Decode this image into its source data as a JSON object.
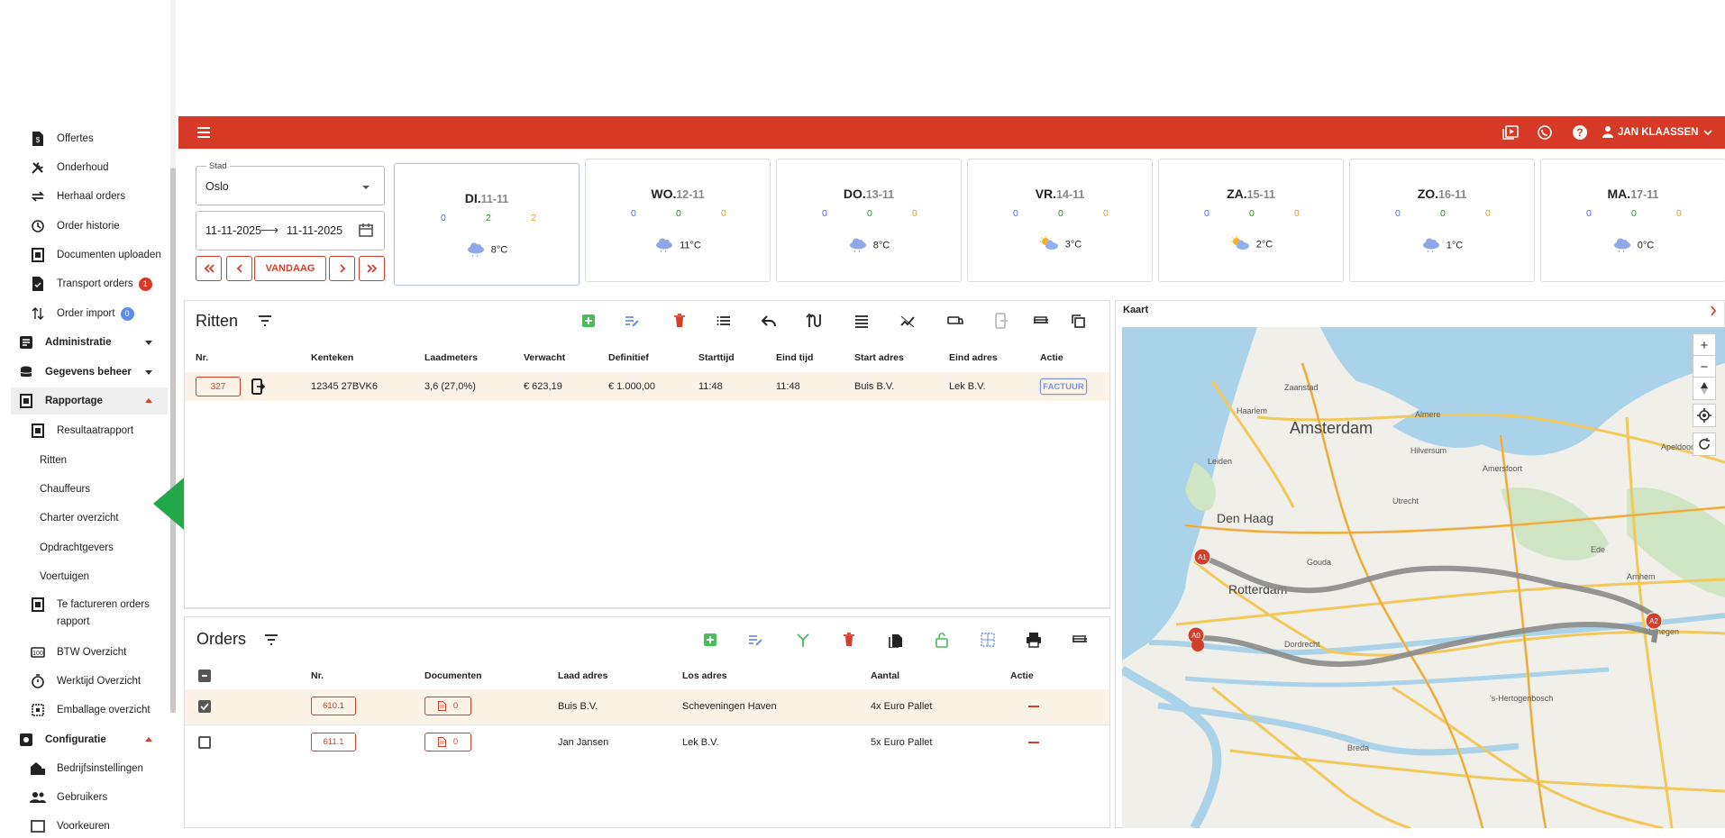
{
  "sidebar": {
    "items": [
      {
        "label": "Offertes",
        "icon": "quote-icon"
      },
      {
        "label": "Onderhoud",
        "icon": "tools-icon"
      },
      {
        "label": "Herhaal orders",
        "icon": "repeat-icon"
      },
      {
        "label": "Order historie",
        "icon": "history-icon"
      },
      {
        "label": "Documenten uploaden",
        "icon": "upload-icon"
      },
      {
        "label": "Transport orders",
        "icon": "document-check-icon",
        "badge": "1"
      },
      {
        "label": "Order import",
        "icon": "import-icon",
        "badge": "0"
      }
    ],
    "groups": {
      "administratie": "Administratie",
      "gegevens_beheer": "Gegevens beheer",
      "rapportage": "Rapportage",
      "configuratie": "Configuratie"
    },
    "rapportage_items": [
      "Resultaatrapport",
      "Ritten",
      "Chauffeurs",
      "Charter overzicht",
      "Opdrachtgevers",
      "Voertuigen"
    ],
    "te_factureren_line1": "Te factureren orders",
    "te_factureren_line2": "rapport",
    "more_items": [
      "BTW Overzicht",
      "Werktijd Overzicht",
      "Emballage overzicht"
    ],
    "config_items": [
      "Bedrijfsinstellingen",
      "Gebruikers",
      "Voorkeuren"
    ]
  },
  "topbar": {
    "user": "JAN KLAASSEN",
    "color": "#d63a26"
  },
  "filters": {
    "city_label": "Stad",
    "city_value": "Oslo",
    "date_from": "11-11-2025",
    "date_to": "11-11-2025",
    "today_label": "VANDAAG"
  },
  "days": [
    {
      "name": "DI.",
      "date": "11-11",
      "c1": "0",
      "c2": "2",
      "c3": "2",
      "temp": "8°C",
      "icon": "rain-cloud-icon"
    },
    {
      "name": "WO.",
      "date": "12-11",
      "c1": "0",
      "c2": "0",
      "c3": "0",
      "temp": "11°C",
      "icon": "rain-cloud-icon"
    },
    {
      "name": "DO.",
      "date": "13-11",
      "c1": "0",
      "c2": "0",
      "c3": "0",
      "temp": "8°C",
      "icon": "rain-cloud-icon"
    },
    {
      "name": "VR.",
      "date": "14-11",
      "c1": "0",
      "c2": "0",
      "c3": "0",
      "temp": "3°C",
      "icon": "sun-cloud-icon"
    },
    {
      "name": "ZA.",
      "date": "15-11",
      "c1": "0",
      "c2": "0",
      "c3": "0",
      "temp": "2°C",
      "icon": "sun-cloud-icon"
    },
    {
      "name": "ZO.",
      "date": "16-11",
      "c1": "0",
      "c2": "0",
      "c3": "0",
      "temp": "1°C",
      "icon": "rain-cloud-icon"
    },
    {
      "name": "MA.",
      "date": "17-11",
      "c1": "0",
      "c2": "0",
      "c3": "0",
      "temp": "0°C",
      "icon": "rain-cloud-icon"
    }
  ],
  "ritten": {
    "title": "Ritten",
    "headers": [
      "Nr.",
      "Kenteken",
      "Laadmeters",
      "Verwacht",
      "Definitief",
      "Starttijd",
      "Eind tijd",
      "Start adres",
      "Eind adres",
      "Actie"
    ],
    "rows": [
      {
        "nr": "327",
        "kenteken": "12345 27BVK6",
        "laadmeters": "3,6 (27,0%)",
        "verwacht": "€ 623,19",
        "definitief": "€ 1.000,00",
        "starttijd": "11:48",
        "eindtijd": "11:48",
        "start": "Buis B.V.",
        "eind": "Lek B.V.",
        "actie": "FACTUUR"
      }
    ]
  },
  "orders": {
    "title": "Orders",
    "headers": [
      "Nr.",
      "Documenten",
      "Laad adres",
      "Los adres",
      "Aantal",
      "Actie"
    ],
    "rows": [
      {
        "checked": true,
        "nr": "610.1",
        "docs": "0",
        "laad": "Buis B.V.",
        "los": "Scheveningen Haven",
        "aantal": "4x Euro Pallet"
      },
      {
        "checked": false,
        "nr": "611.1",
        "docs": "0",
        "laad": "Jan Jansen",
        "los": "Lek B.V.",
        "aantal": "5x Euro Pallet"
      }
    ]
  },
  "map": {
    "title": "Kaart",
    "cities": {
      "amsterdam": "Amsterdam",
      "den_haag": "Den Haag",
      "rotterdam": "Rotterdam",
      "zaanstad": "Zaanstad",
      "haarlem": "Haarlem",
      "almere": "Almere",
      "utrecht": "Utrecht",
      "amersfoort": "Amersfoort",
      "nijmegen": "Nijmegen",
      "apeldoorn": "Apeldoorn",
      "hertogenbosch": "'s-Hertogenbosch",
      "dordrecht": "Dordrecht",
      "leiden": "Leiden",
      "gouda": "Gouda",
      "hilversum": "Hilversum",
      "ede": "Ede",
      "arnhem": "Arnhem",
      "breda": "Breda"
    },
    "markers": [
      "A1",
      "A0",
      "A2"
    ]
  }
}
